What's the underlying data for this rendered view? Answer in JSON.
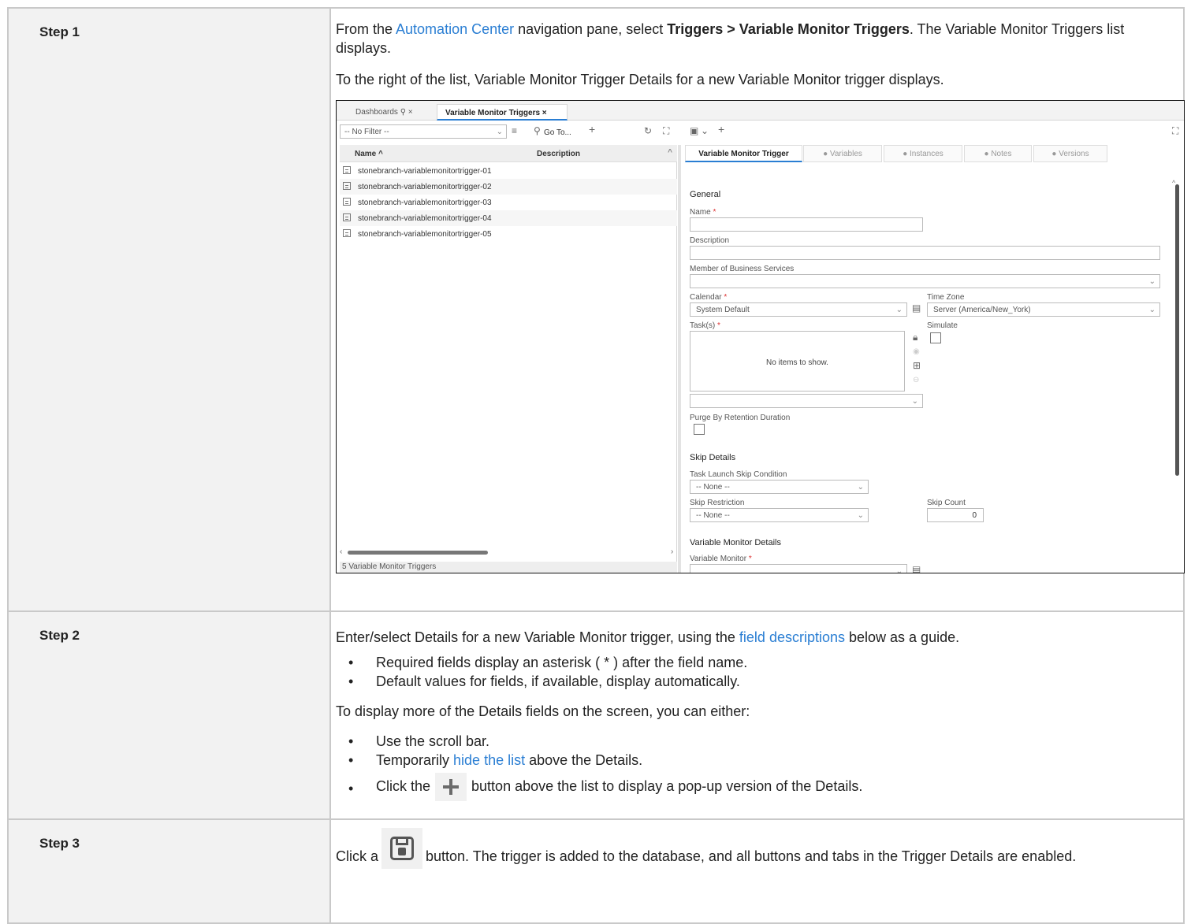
{
  "steps": {
    "step1": {
      "label": "Step 1",
      "p1_before": "From the ",
      "p1_link": "Automation Center",
      "p1_middle": " navigation pane, select ",
      "p1_bold": "Triggers > Variable Monitor Triggers",
      "p1_after": ". The Variable Monitor Triggers list displays.",
      "p2": "To the right of the list, Variable Monitor Trigger Details for a new Variable Monitor trigger displays."
    },
    "step2": {
      "label": "Step 2",
      "p1_before": "Enter/select Details for a new Variable Monitor trigger, using the ",
      "p1_link": "field descriptions",
      "p1_after": " below as a guide.",
      "bullets1": [
        "Required fields display an asterisk ( * ) after the field name.",
        "Default values for fields, if available, display automatically."
      ],
      "p2": "To display more of the Details fields on the screen, you can either:",
      "b2_1": "Use the scroll bar.",
      "b2_2_before": "Temporarily ",
      "b2_2_link": "hide the list",
      "b2_2_after": " above the Details.",
      "b2_3_before": "Click the",
      "b2_3_after": "button above the list to display a pop-up version of the Details.",
      "bullet_glyph": "•"
    },
    "step3": {
      "label": "Step 3",
      "before": "Click a",
      "after": "button. The trigger is added to the database, and all buttons and tabs in the Trigger Details are enabled."
    }
  },
  "screenshot": {
    "doc_tabs": [
      "Dashboards ⚲ ×",
      "Variable Monitor Triggers ×"
    ],
    "filter": "-- No Filter --",
    "goto": "Go To...",
    "columns": {
      "name": "Name ^",
      "description": "Description"
    },
    "rows": [
      "stonebranch-variablemonitortrigger-01",
      "stonebranch-variablemonitortrigger-02",
      "stonebranch-variablemonitortrigger-03",
      "stonebranch-variablemonitortrigger-04",
      "stonebranch-variablemonitortrigger-05"
    ],
    "footer": "5 Variable Monitor Triggers",
    "detail_tabs": [
      "Variable Monitor Trigger",
      "● Variables",
      "● Instances",
      "● Notes",
      "● Versions"
    ],
    "general": "General",
    "name_label": "Name",
    "description_label": "Description",
    "business_label": "Member of Business Services",
    "calendar_label": "Calendar",
    "calendar_value": "System Default",
    "timezone_label": "Time Zone",
    "timezone_value": "Server (America/New_York)",
    "tasks_label": "Task(s)",
    "no_items": "No items to show.",
    "simulate_label": "Simulate",
    "purge_label": "Purge By Retention Duration",
    "skip_details": "Skip Details",
    "skip_condition_label": "Task Launch Skip Condition",
    "none_value": "-- None --",
    "skip_restriction_label": "Skip Restriction",
    "skip_count_label": "Skip Count",
    "skip_count_value": "0",
    "vm_details": "Variable Monitor Details",
    "vm_label": "Variable Monitor",
    "asterisk": "*"
  },
  "colors": {
    "link": "#2a7ed3",
    "label_bg": "#f2f2f2",
    "border": "#c9c9c9",
    "required": "#d33"
  }
}
